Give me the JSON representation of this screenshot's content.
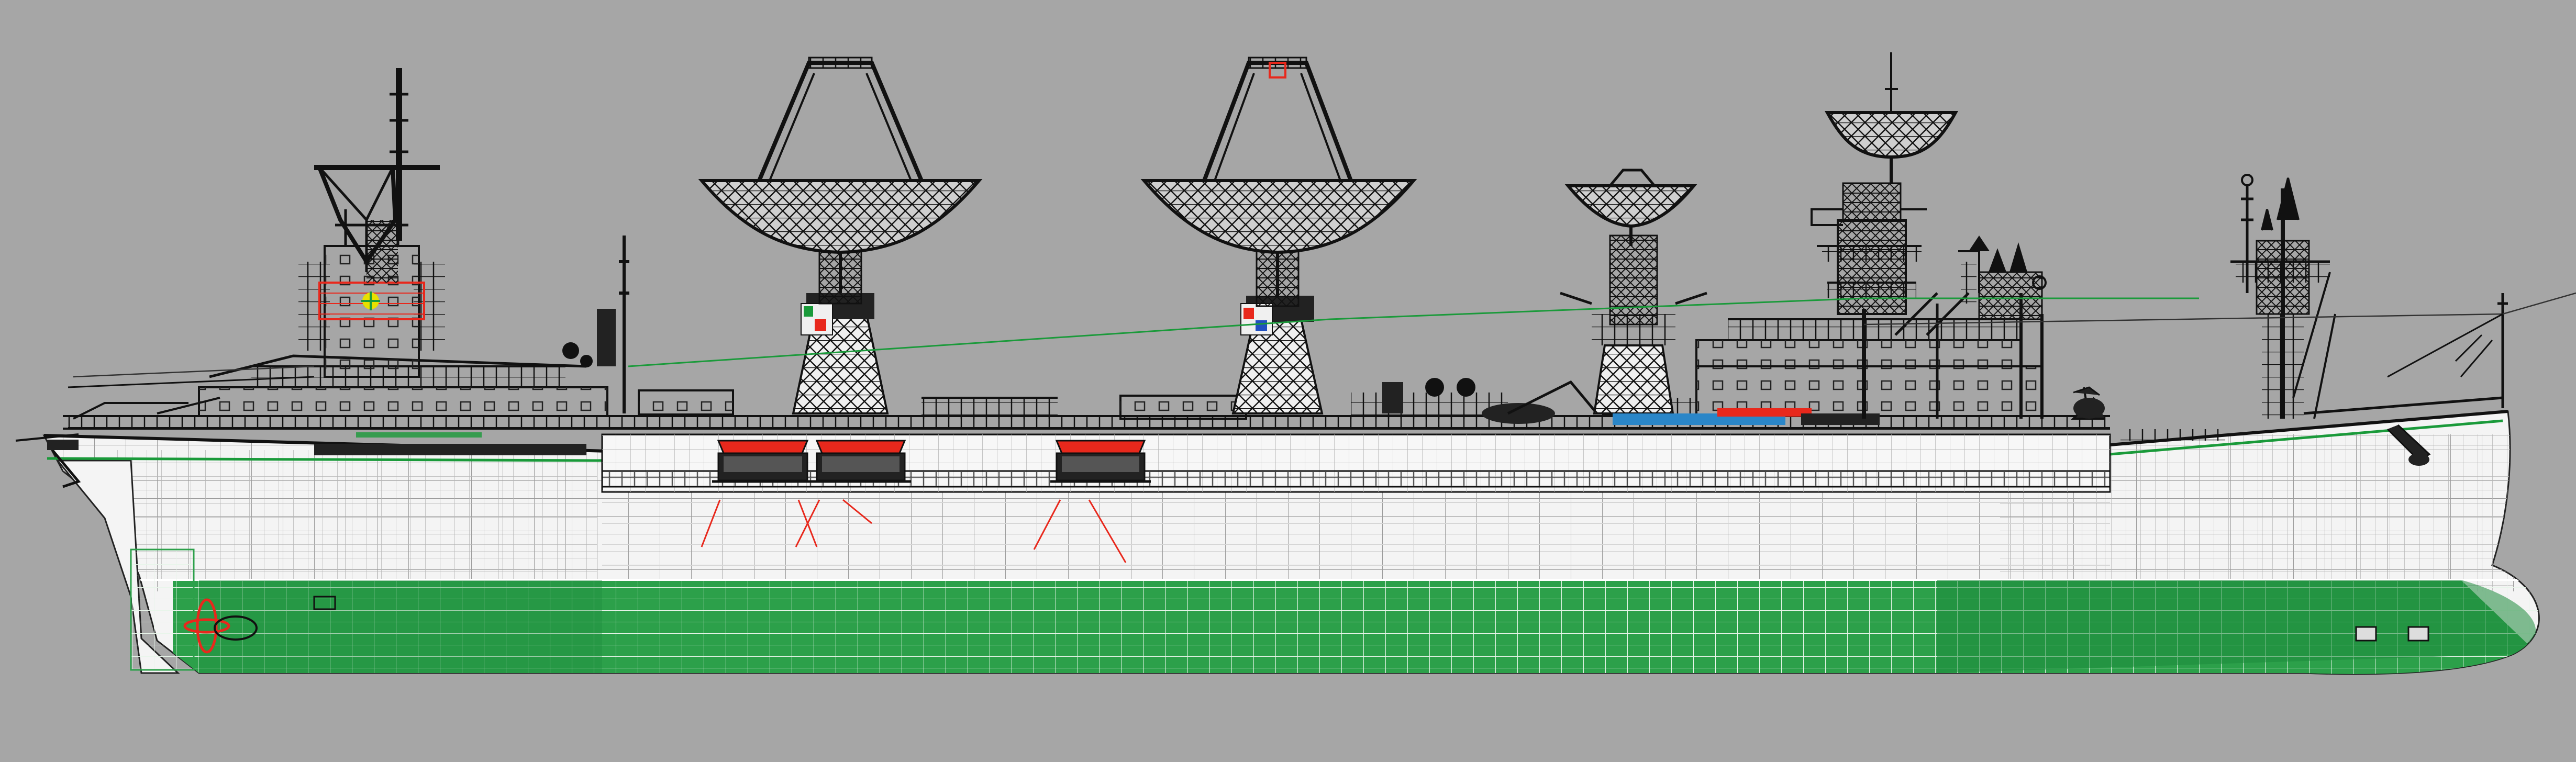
{
  "drawing": {
    "subject": "ship-wireframe-side-elevation",
    "colors": {
      "background": "#a6a6a6",
      "hull_topside_fill": "#f4f4f4",
      "hull_topside_lines": "#9c9c9c",
      "hull_underwater_fill": "#2ca04a",
      "hull_underwater_lines": "#e8f5ea",
      "superstructure_lines": "#111111",
      "accent_red": "#e8281c",
      "accent_green": "#1a9a3a",
      "lifeboat_hull": "#222222"
    },
    "antennas": [
      {
        "name": "antenna-1-large"
      },
      {
        "name": "antenna-2-large"
      },
      {
        "name": "antenna-3-small"
      },
      {
        "name": "antenna-4-tower"
      }
    ],
    "lifeboats": [
      {
        "name": "lifeboat-1"
      },
      {
        "name": "lifeboat-2"
      },
      {
        "name": "lifeboat-3"
      }
    ]
  }
}
